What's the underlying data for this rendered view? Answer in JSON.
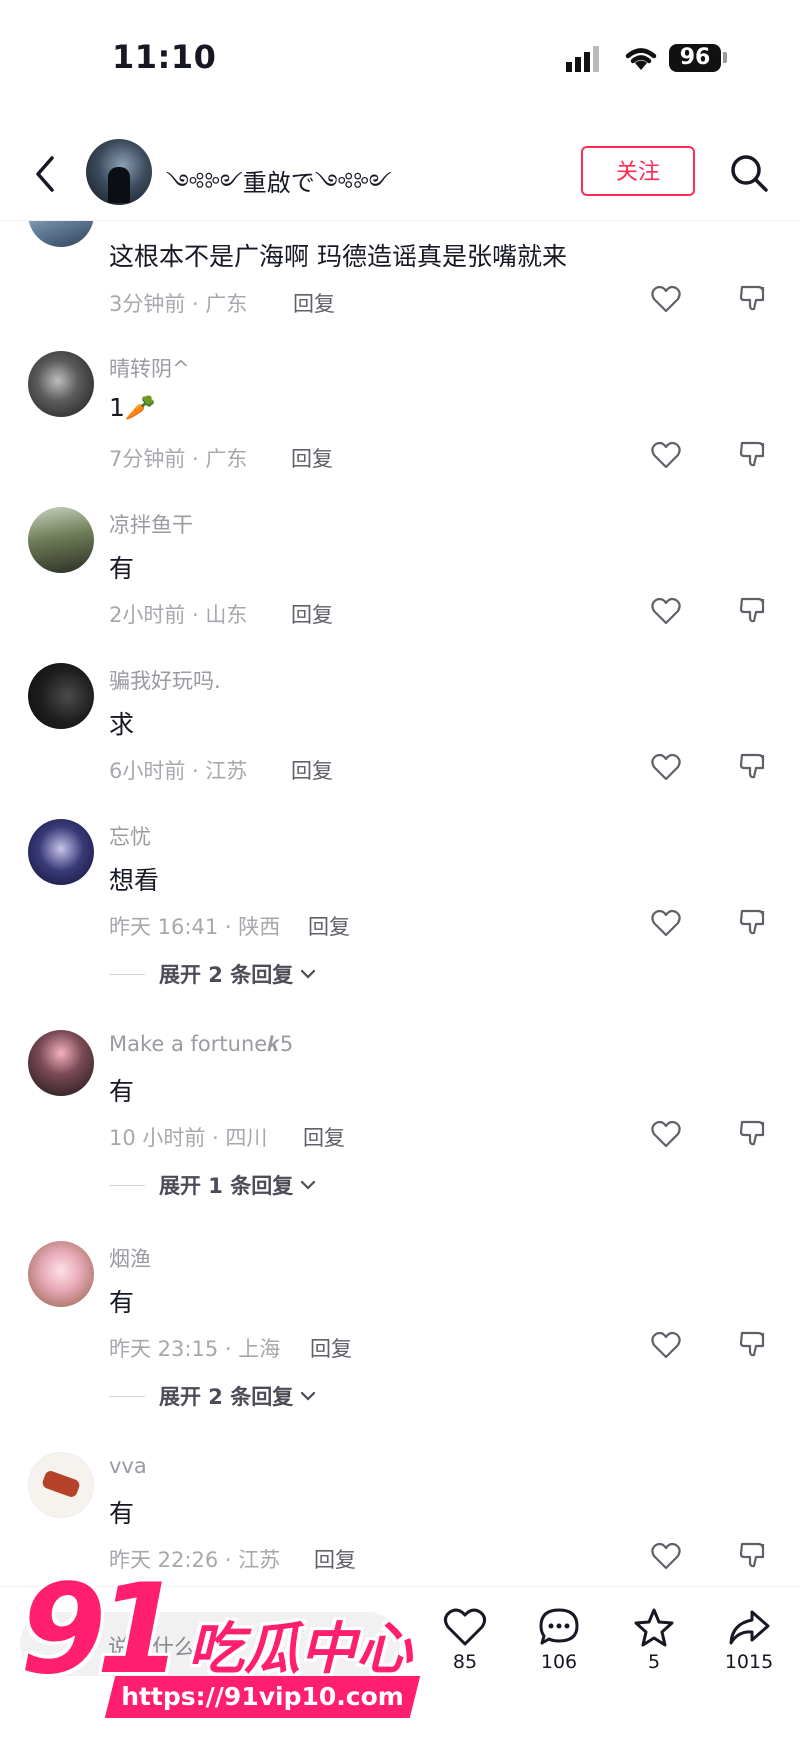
{
  "status_bar": {
    "time": "11:10",
    "battery": "96"
  },
  "header": {
    "username": "༺༻重啟で༺༻",
    "follow_label": "关注"
  },
  "comments": [
    {
      "name": "",
      "text": "这根本不是广海啊 玛德造谣真是张嘴就来",
      "meta": "3分钟前 · 广东",
      "reply": "回复"
    },
    {
      "name": "晴转阴^",
      "text": "1🥕",
      "meta": "7分钟前 · 广东",
      "reply": "回复"
    },
    {
      "name": "凉拌鱼干",
      "text": "有",
      "meta": "2小时前 · 山东",
      "reply": "回复"
    },
    {
      "name": "骗我好玩吗.",
      "text": "求",
      "meta": "6小时前 · 江苏",
      "reply": "回复"
    },
    {
      "name": "忘忧",
      "text": "想看",
      "meta": "昨天 16:41 · 陕西",
      "reply": "回复",
      "expand": "展开 2 条回复"
    },
    {
      "name": "Make a fortune𝒌5",
      "text": "有",
      "meta": "10 小时前 · 四川",
      "reply": "回复",
      "expand": "展开 1 条回复"
    },
    {
      "name": "烟渔",
      "text": "有",
      "meta": "昨天 23:15 · 上海",
      "reply": "回复",
      "expand": "展开 2 条回复"
    },
    {
      "name": "vva",
      "text": "有",
      "meta": "昨天 22:26 · 江苏",
      "reply": "回复"
    }
  ],
  "bottom_bar": {
    "input_placeholder": "说点什么...",
    "likes": "85",
    "comments": "106",
    "favorites": "5",
    "shares": "1015"
  },
  "watermark": {
    "number": "91",
    "name": "吃瓜中心",
    "url": "https://91vip10.com"
  },
  "colors": {
    "accent": "#fe2c55",
    "watermark": "#ff1f6e"
  }
}
